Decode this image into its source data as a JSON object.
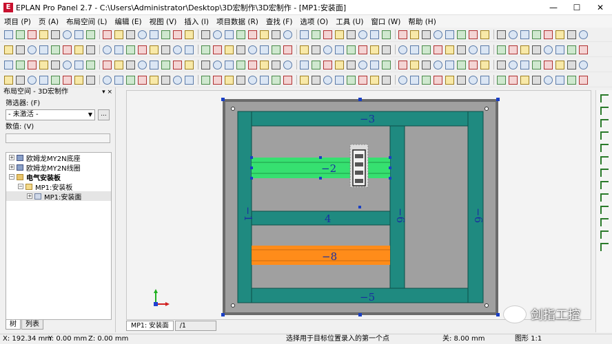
{
  "window": {
    "title": "EPLAN Pro Panel 2.7 - C:\\Users\\Administrator\\Desktop\\3D宏制作\\3D宏制作 - [MP1:安装面]",
    "controls": [
      "—",
      "☐",
      "✕"
    ]
  },
  "menu": [
    "项目 (P)",
    "页 (A)",
    "布局空间 (L)",
    "编辑 (E)",
    "视图 (V)",
    "插入 (I)",
    "项目数据 (R)",
    "查找 (F)",
    "选项 (O)",
    "工具 (U)",
    "窗口 (W)",
    "帮助 (H)"
  ],
  "panel": {
    "title": "布局空间 - 3D宏制作",
    "controls": "▾ ×",
    "filter_label": "筛选器: (F)",
    "filter_value": "- 未激活 -",
    "dots": "...",
    "values_label": "数值: (V)",
    "tree": [
      {
        "label": "欧姆龙MY2N底座",
        "level": 0,
        "expander": "+",
        "icon": "comp"
      },
      {
        "label": "欧姆龙MY2N线圈",
        "level": 0,
        "expander": "+",
        "icon": "comp"
      },
      {
        "label": "电气安装板",
        "level": 0,
        "expander": "−",
        "icon": "folder",
        "bold": true
      },
      {
        "label": "MP1:安装板",
        "level": 1,
        "expander": "−",
        "icon": "plate"
      },
      {
        "label": "MP1:安装面",
        "level": 2,
        "expander": "+",
        "icon": "face",
        "selected": true
      }
    ],
    "tabs": [
      "树",
      "列表"
    ]
  },
  "drawing": {
    "labels": {
      "top": "−3",
      "upper_rail": "−2",
      "left_duct": "−1",
      "middle_duct": "4",
      "center_duct": "−6",
      "right_duct": "−6",
      "lower_rail": "−8",
      "bottom": "−5"
    },
    "colors": {
      "plate_border": "#6b6b6b",
      "plate": "#a0a0a0",
      "duct": "#1f8a80",
      "rail_green": "#36e070",
      "rail_orange": "#ff8c1a",
      "handle": "#1a3fc4",
      "canvas_bg": "#f3f3f3"
    }
  },
  "page_tabs": [
    "MP1: 安装面",
    "/1"
  ],
  "status": {
    "x": "X: 192.34 mm",
    "y": "Y: 0.00 mm",
    "z": "Z: 0.00 mm",
    "hint": "选择用于目标位置录入的第一个点",
    "off": "关: 8.00 mm",
    "grid": "图形 1:1"
  },
  "watermark": "剑指工控"
}
